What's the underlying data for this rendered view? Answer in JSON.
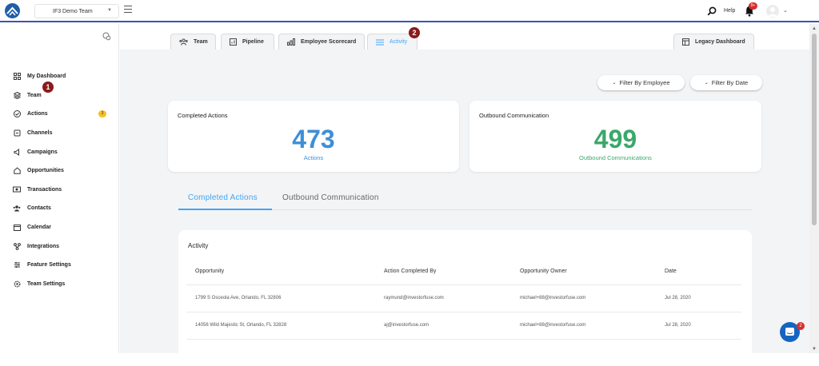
{
  "header": {
    "team_select": "IF3 Demo Team",
    "help": "Help",
    "notifications_badge": "9+"
  },
  "sidebar": {
    "items": [
      {
        "label": "My Dashboard",
        "icon": "grid-icon"
      },
      {
        "label": "Team",
        "icon": "layers-icon"
      },
      {
        "label": "Actions",
        "icon": "check-circle-icon",
        "badge": "3"
      },
      {
        "label": "Channels",
        "icon": "share-icon"
      },
      {
        "label": "Campaigns",
        "icon": "megaphone-icon"
      },
      {
        "label": "Opportunities",
        "icon": "house-icon"
      },
      {
        "label": "Transactions",
        "icon": "cash-icon"
      },
      {
        "label": "Contacts",
        "icon": "people-icon"
      },
      {
        "label": "Calendar",
        "icon": "calendar-icon"
      },
      {
        "label": "Integrations",
        "icon": "integration-icon"
      },
      {
        "label": "Feature Settings",
        "icon": "sliders-icon"
      },
      {
        "label": "Team Settings",
        "icon": "gear-icon"
      }
    ]
  },
  "markers": {
    "one": "1",
    "two": "2"
  },
  "tabs": {
    "team": "Team",
    "pipeline": "Pipeline",
    "employee_scorecard": "Employee Scorecard",
    "activity": "Activity",
    "legacy_dashboard": "Legacy Dashboard"
  },
  "filters": {
    "by_employee": "Filter By Employee",
    "by_date": "Filter By Date"
  },
  "cards": {
    "completed": {
      "title": "Completed Actions",
      "value": "473",
      "subtitle": "Actions",
      "color": "#3d8fd6"
    },
    "outbound": {
      "title": "Outbound Communication",
      "value": "499",
      "subtitle": "Outbound Communications",
      "color": "#3aa86b"
    }
  },
  "subtabs": {
    "completed": "Completed Actions",
    "outbound": "Outbound Communication"
  },
  "table": {
    "title": "Activity",
    "columns": [
      "Opportunity",
      "Action Completed By",
      "Opportunity Owner",
      "Date"
    ],
    "rows": [
      [
        "1799 S Osceola Ave, Orlando, FL 32806",
        "raymund@investorfuse.com",
        "michael+88@investorfuse.com",
        "Jul 28, 2020"
      ],
      [
        "14056 Wild Majestic St, Orlando, FL 32828",
        "aj@investorfuse.com",
        "michael+88@investorfuse.com",
        "Jul 28, 2020"
      ]
    ]
  },
  "chat": {
    "badge": "2"
  },
  "colors": {
    "accent": "#42a5f5",
    "brand": "#1e5ea8",
    "header_border": "#3f51b5"
  }
}
